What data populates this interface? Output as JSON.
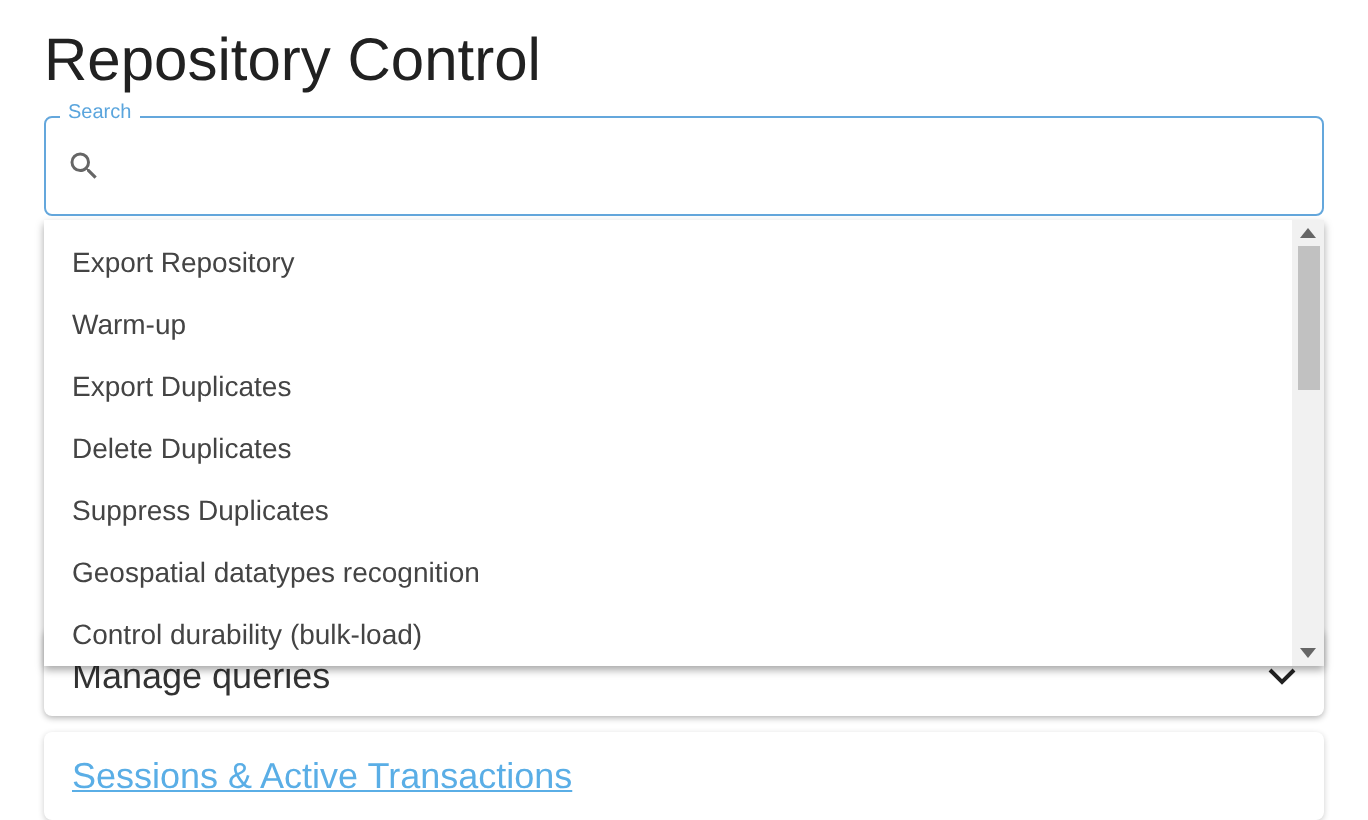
{
  "title": "Repository Control",
  "search": {
    "label": "Search"
  },
  "dropdown": {
    "items": [
      "Export Repository",
      "Warm-up",
      "Export Duplicates",
      "Delete Duplicates",
      "Suppress Duplicates",
      "Geospatial datatypes recognition",
      "Control durability (bulk-load)"
    ]
  },
  "panels": [
    {
      "kind": "accordion",
      "label": "Manage queries",
      "expanded": false
    },
    {
      "kind": "link",
      "label": "Sessions & Active Transactions"
    }
  ]
}
